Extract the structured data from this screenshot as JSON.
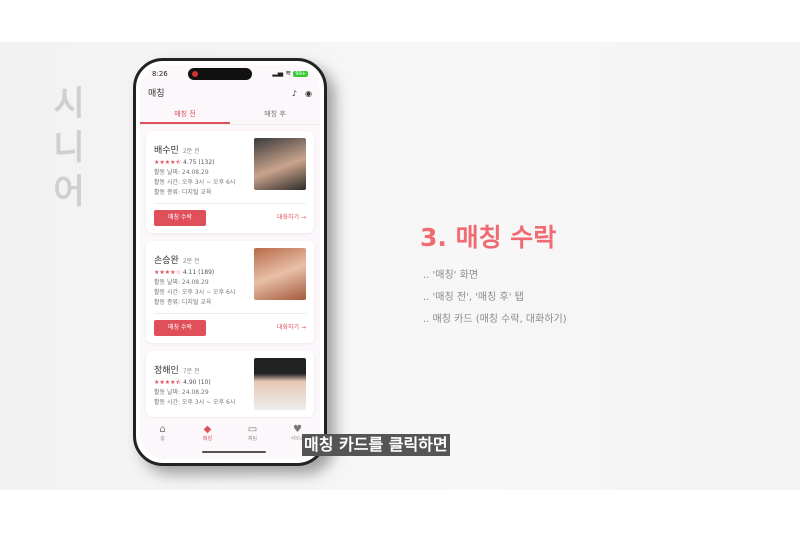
{
  "side_text": "시니어",
  "status": {
    "time": "8:26",
    "battery": "99+"
  },
  "header": {
    "title": "매칭"
  },
  "tabs": [
    "매칭 전",
    "매칭 후"
  ],
  "cards": [
    {
      "name": "배수민",
      "ago": "2분 전",
      "stars": "★★★★⯪",
      "rating": "4.75 (132)",
      "date": "활동 날짜:  24.08.29",
      "time": "활동 시간:  오후 3시 ~ 오후 6시",
      "type": "활동 종류:  디지털 교육",
      "accept": "매칭 수락",
      "chat": "대화하기 →"
    },
    {
      "name": "손승완",
      "ago": "2분 전",
      "stars": "★★★★☆",
      "rating": "4.11 (189)",
      "date": "활동 날짜:  24.08.29",
      "time": "활동 시간:  오후 3시 ~ 오후 6시",
      "type": "활동 종류:  디지털 교육",
      "accept": "매칭 수락",
      "chat": "대화하기 →"
    },
    {
      "name": "정해인",
      "ago": "7분 전",
      "stars": "★★★★⯪",
      "rating": "4.90 (10)",
      "date": "활동 날짜:  24.08.29",
      "time": "활동 시간:  오후 3시 ~ 오후 6시"
    }
  ],
  "nav": [
    "홈",
    "매칭",
    "채팅",
    "서비스"
  ],
  "slide": {
    "title": "3. 매칭 수락",
    "bullets": [
      ".. '매칭' 화면",
      ".. '매칭 전', '매칭 후' 탭",
      ".. 매칭 카드 (매칭 수락, 대화하기)"
    ]
  },
  "subtitle": "매칭 카드를 클릭하면",
  "colors": {
    "accent": "#e0505b",
    "title": "#f06a72"
  }
}
